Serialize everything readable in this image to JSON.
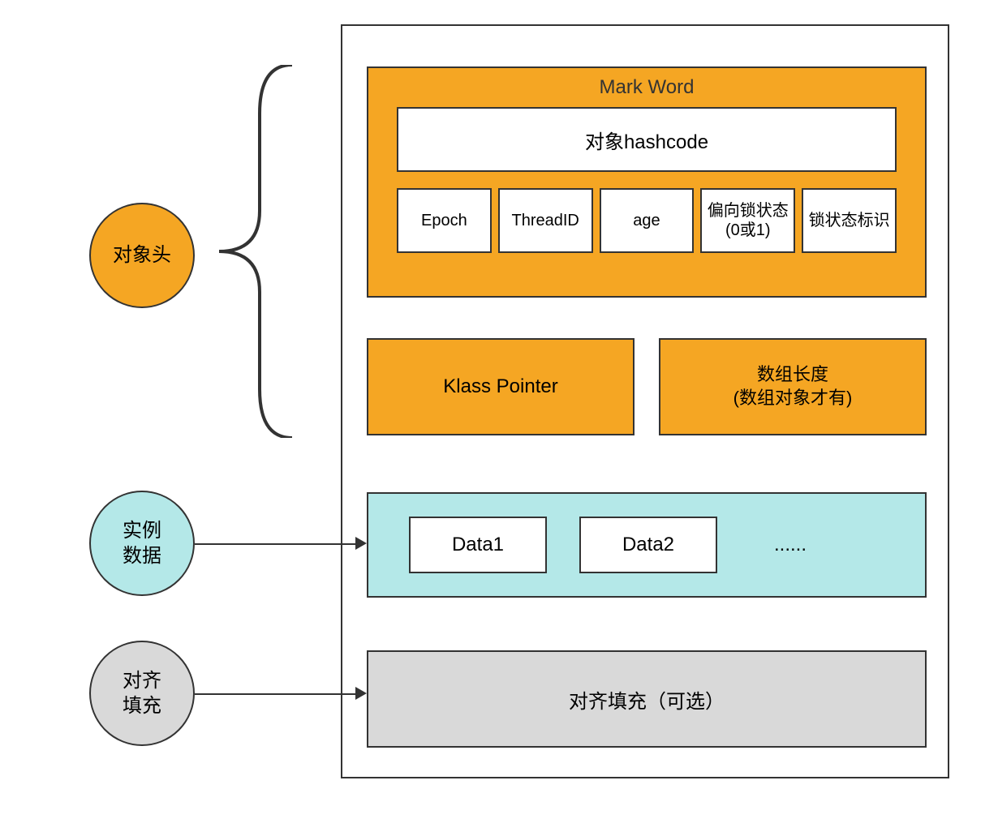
{
  "circles": {
    "header": "对象头",
    "instance": [
      "实例",
      "数据"
    ],
    "padding": [
      "对齐",
      "填充"
    ]
  },
  "markWord": {
    "title": "Mark Word",
    "hashcode": "对象hashcode",
    "fields": [
      "Epoch",
      "ThreadID",
      "age",
      "偏向锁状态(0或1)",
      "锁状态标识"
    ]
  },
  "klassPointer": "Klass Pointer",
  "arrayLength": [
    "数组长度",
    "(数组对象才有)"
  ],
  "instanceData": {
    "items": [
      "Data1",
      "Data2"
    ],
    "more": "......"
  },
  "padding": "对齐填充（可选）",
  "colors": {
    "orange": "#F5A623",
    "teal": "#B4E8E8",
    "gray": "#D9D9D9"
  }
}
